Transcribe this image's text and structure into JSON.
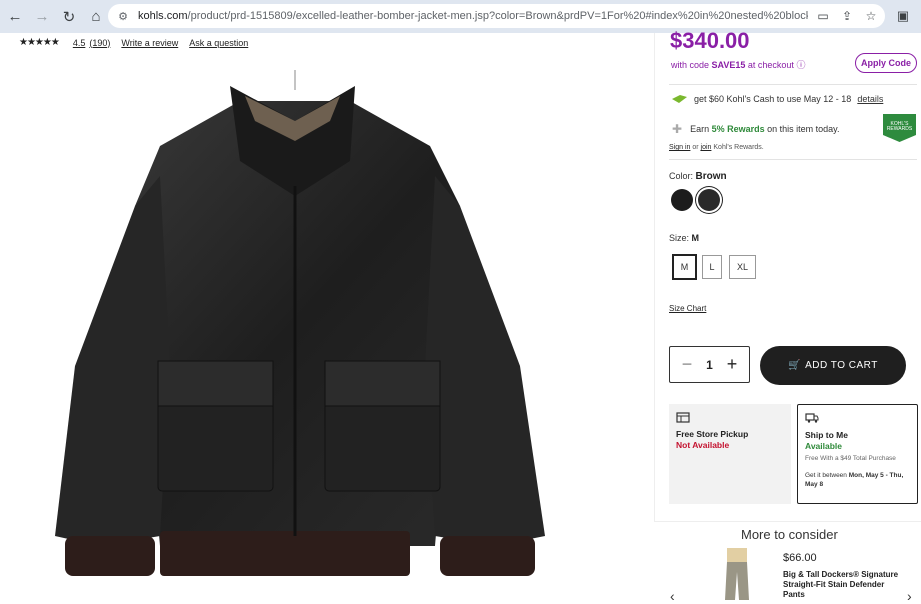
{
  "browser": {
    "url_host": "kohls.com",
    "url_path": "/product/prd-1515809/excelled-leather-bomber-jacket-men.jsp?color=Brown&prdPV=1For%20#index%20in%20nested%20block%20use%20#g..."
  },
  "rating": {
    "stars": "★★★★★",
    "value": "4.5",
    "count": "(190)",
    "write_review": "Write a review",
    "ask_question": "Ask a question"
  },
  "product": {
    "price": "$340.00",
    "code_prefix": "with code ",
    "code": "SAVE15",
    "code_suffix": " at checkout",
    "info_icon": "ⓘ",
    "apply_code": "Apply Code",
    "cash_text": "get $60 Kohl's Cash to use May 12 - 18",
    "cash_link": "details",
    "rewards_prefix": "Earn ",
    "rewards_bold": "5% Rewards",
    "rewards_suffix": " on this item today.",
    "rewards_badge": "KOHL'S REWARDS",
    "signin": "Sign in",
    "or": " or ",
    "join": "join",
    "signin_suffix": " Kohl's Rewards.",
    "color_label": "Color: ",
    "color_value": "Brown",
    "size_label": "Size: ",
    "size_value": "M",
    "sizes": [
      "M",
      "L",
      "XL"
    ],
    "size_chart": "Size Chart",
    "quantity": "1",
    "minus": "−",
    "plus": "+",
    "add_to_cart": "ADD TO CART"
  },
  "shipping": {
    "pickup_title": "Free Store Pickup",
    "pickup_status": "Not Available",
    "ship_title": "Ship to Me",
    "ship_status": "Available",
    "ship_note": "Free With a $49 Total Purchase",
    "ship_date_prefix": "Get it between ",
    "ship_date": "Mon, May 5 - Thu, May 8"
  },
  "more": {
    "title": "More to consider",
    "item_price": "$66.00",
    "item_name": "Big & Tall Dockers® Signature Straight-Fit Stain Defender Pants"
  },
  "colors": {
    "brand_purple": "#8a1fa6",
    "green": "#2f8a3a",
    "red": "#c4122f",
    "dark": "#1f1f1f"
  }
}
